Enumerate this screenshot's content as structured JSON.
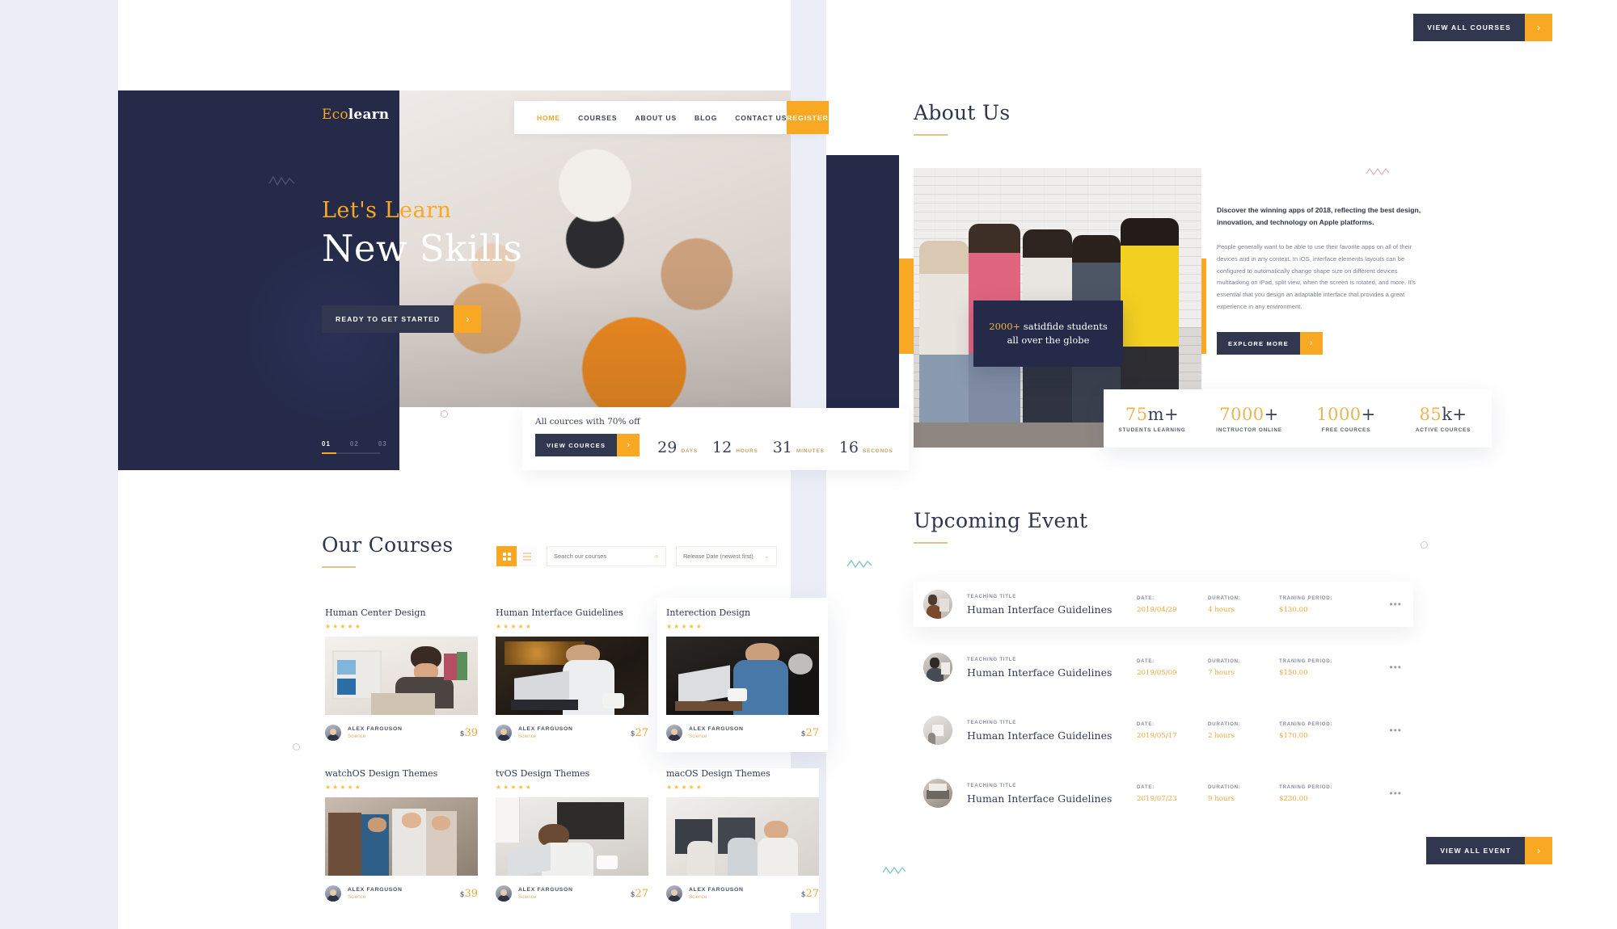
{
  "hero": {
    "brand_eco": "Eco",
    "brand_learn": "learn",
    "nav": [
      {
        "label": "HOME",
        "active": true
      },
      {
        "label": "COURSES",
        "active": false
      },
      {
        "label": "ABOUT US",
        "active": false
      },
      {
        "label": "BLOG",
        "active": false
      },
      {
        "label": "CONTACT US",
        "active": false
      }
    ],
    "register_label": "REGISTER",
    "subtitle": "Let's Learn",
    "title": "New Skills",
    "cta_label": "READY TO GET STARTED",
    "slides": [
      "01",
      "02",
      "03"
    ]
  },
  "countdown": {
    "offer": "All cources with 70% off",
    "button_label": "VIEW COURCES",
    "units": [
      {
        "value": "29",
        "label": "DAYS"
      },
      {
        "value": "12",
        "label": "HOURS"
      },
      {
        "value": "31",
        "label": "MINUTES"
      },
      {
        "value": "16",
        "label": "SECONDS"
      }
    ]
  },
  "courses": {
    "title": "Our Courses",
    "search_placeholder": "Search our courses",
    "sort_value": "Release Date (newest first)",
    "view_grid": "grid-view",
    "view_list": "list-view",
    "items": [
      {
        "title": "Human Center Design",
        "stars": "★★★★★",
        "author": "ALEX FARGUSON",
        "role": "Science",
        "currency": "$",
        "price": "39",
        "featured": false
      },
      {
        "title": "Human Interface Guidelines",
        "stars": "★★★★★",
        "author": "ALEX FARGUSON",
        "role": "Science",
        "currency": "$",
        "price": "27",
        "featured": false
      },
      {
        "title": "Interection Design",
        "stars": "★★★★★",
        "author": "ALEX FARGUSON",
        "role": "Science",
        "currency": "$",
        "price": "27",
        "featured": true
      },
      {
        "title": "watchOS Design Themes",
        "stars": "★★★★★",
        "author": "ALEX FARGUSON",
        "role": "Science",
        "currency": "$",
        "price": "39",
        "featured": false
      },
      {
        "title": "tvOS Design Themes",
        "stars": "★★★★★",
        "author": "ALEX FARGUSON",
        "role": "Science",
        "currency": "$",
        "price": "27",
        "featured": false
      },
      {
        "title": "macOS Design Themes",
        "stars": "★★★★★",
        "author": "ALEX FARGUSON",
        "role": "Science",
        "currency": "$",
        "price": "27",
        "featured": false
      }
    ]
  },
  "top_button": {
    "label": "VIEW ALL COURSES"
  },
  "about": {
    "title": "About Us",
    "card_highlight": "2000+",
    "card_line1": " satidfide students",
    "card_line2": "all over the globe",
    "lead": "Discover the winning apps of 2018, reflecting the best design, innovation, and technology on Apple platforms.",
    "body": "People generally want to be able to use their favorite apps on all of their devices and in any context. In iOS, interface elements layouts can be configured to automatically change shape size on different devices multitasking on iPad, split view, when the screen is rotated, and more. It's essential that you design an adaptable interface that provides a great experience in any environment.",
    "cta_label": "EXPLORE MORE",
    "stats": [
      {
        "number": "75",
        "suffix": "m+",
        "label": "STUDENTS LEARNING"
      },
      {
        "number": "7000",
        "suffix": "+",
        "label": "INCTRUCTOR ONLINE"
      },
      {
        "number": "1000",
        "suffix": "+",
        "label": "FREE COURCES"
      },
      {
        "number": "85",
        "suffix": "k+",
        "label": "ACTIVE COURCES"
      }
    ]
  },
  "events": {
    "title": "Upcoming Event",
    "col_title_label": "TEACHING TITLE",
    "col_date_label": "DATE:",
    "col_duration_label": "DURATION:",
    "col_period_label": "TRANING PERIOD:",
    "rows": [
      {
        "title": "Human Interface Guidelines",
        "date": "2019/04/29",
        "duration": "4 hours",
        "period": "$130.00"
      },
      {
        "title": "Human Interface Guidelines",
        "date": "2019/05/09",
        "duration": "7 hours",
        "period": "$150.00"
      },
      {
        "title": "Human Interface Guidelines",
        "date": "2019/05/17",
        "duration": "2 hours",
        "period": "$170.00"
      },
      {
        "title": "Human Interface Guidelines",
        "date": "2019/07/23",
        "duration": "9 hours",
        "period": "$230.00"
      }
    ],
    "view_all_label": "VIEW ALL EVENT"
  },
  "icons": {
    "chevron_right": "›",
    "chevron_down": "⌄",
    "search": "⌕",
    "more": "•••"
  },
  "colors": {
    "navy": "#242a48",
    "orange": "#f8a822",
    "gold": "#e9b457",
    "page_bg": "#eceef7"
  }
}
